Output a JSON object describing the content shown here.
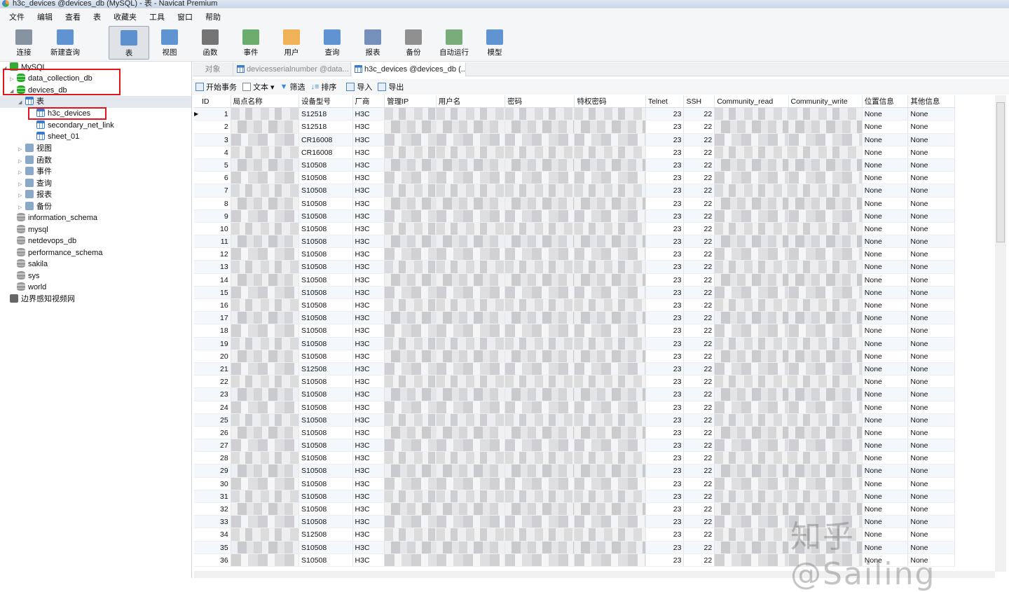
{
  "window_title": "h3c_devices @devices_db (MySQL) - 表 - Navicat Premium",
  "menu": [
    "文件",
    "编辑",
    "查看",
    "表",
    "收藏夹",
    "工具",
    "窗口",
    "帮助"
  ],
  "toolbar": [
    {
      "label": "连接",
      "icon": "connect-icon"
    },
    {
      "label": "新建查询",
      "icon": "new-query-icon"
    },
    {
      "label": "表",
      "icon": "table-icon",
      "active": true
    },
    {
      "label": "视图",
      "icon": "view-icon"
    },
    {
      "label": "函数",
      "icon": "function-icon"
    },
    {
      "label": "事件",
      "icon": "event-clock-icon"
    },
    {
      "label": "用户",
      "icon": "user-icon"
    },
    {
      "label": "查询",
      "icon": "query-icon"
    },
    {
      "label": "报表",
      "icon": "report-icon"
    },
    {
      "label": "备份",
      "icon": "backup-icon"
    },
    {
      "label": "自动运行",
      "icon": "schedule-icon"
    },
    {
      "label": "模型",
      "icon": "model-icon"
    }
  ],
  "tree": {
    "connection": "MySQL",
    "db1": "data_collection_db",
    "db2": "devices_db",
    "tables_label": "表",
    "tables": [
      "h3c_devices",
      "secondary_net_link",
      "sheet_01"
    ],
    "groups": [
      "视图",
      "函数",
      "事件",
      "查询",
      "报表",
      "备份"
    ],
    "other_dbs": [
      "information_schema",
      "mysql",
      "netdevops_db",
      "performance_schema",
      "sakila",
      "sys",
      "world"
    ],
    "other_connection": "边界感知视频网"
  },
  "tabs": {
    "objects": "对象",
    "tab1": "devicesserialnumber @data...",
    "tab2": "h3c_devices @devices_db (..."
  },
  "subtoolbar": {
    "begin": "开始事务",
    "text": "文本",
    "filter": "筛选",
    "sort": "排序",
    "import": "导入",
    "export": "导出"
  },
  "columns": [
    "ID",
    "局点名称",
    "设备型号",
    "厂商",
    "管理IP",
    "用户名",
    "密码",
    "特权密码",
    "Telnet",
    "SSH",
    "Community_read",
    "Community_write",
    "位置信息",
    "其他信息"
  ],
  "models": [
    "S12518",
    "S12518",
    "CR16008",
    "CR16008",
    "S10508",
    "S10508",
    "S10508",
    "S10508",
    "S10508",
    "S10508",
    "S10508",
    "S10508",
    "S10508",
    "S10508",
    "S10508",
    "S10508",
    "S10508",
    "S10508",
    "S10508",
    "S10508",
    "S12508",
    "S10508",
    "S10508",
    "S10508",
    "S10508",
    "S10508",
    "S10508",
    "S10508",
    "S10508",
    "S10508",
    "S10508",
    "S10508",
    "S10508",
    "S12508",
    "S10508",
    "S10508"
  ],
  "vendor": "H3C",
  "telnet": "23",
  "ssh": "22",
  "location": "None",
  "other": "None",
  "watermark": "知乎 @Sailing"
}
